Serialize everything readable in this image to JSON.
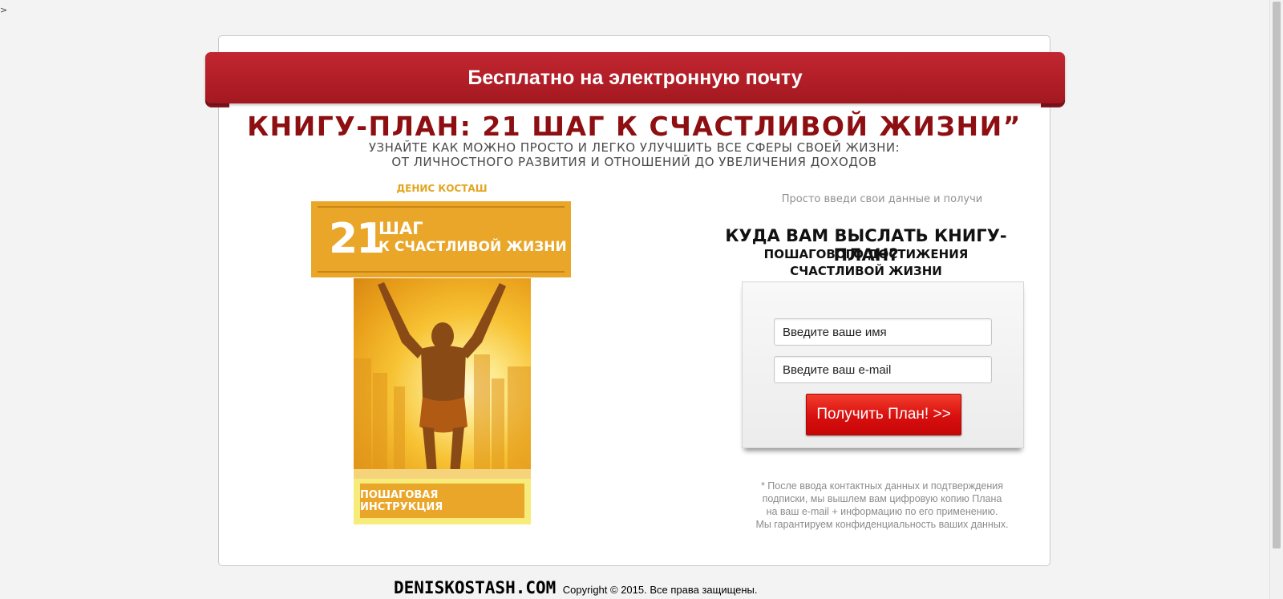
{
  "page": {
    "stray_mark": ">"
  },
  "banner": {
    "title": "Бесплатно на электронную почту"
  },
  "headline": {
    "title": "КНИГУ-ПЛАН: 21 ШАГ К СЧАСТЛИВОЙ ЖИЗНИ”",
    "subtitle_line1": "УЗНАЙТЕ КАК МОЖНО ПРОСТО И ЛЕГКО УЛУЧШИТЬ ВСЕ СФЕРЫ СВОЕЙ ЖИЗНИ:",
    "subtitle_line2": "ОТ ЛИЧНОСТНОГО РАЗВИТИЯ И ОТНОШЕНИЙ  ДО УВЕЛИЧЕНИЯ ДОХОДОВ"
  },
  "book_cover": {
    "author": "ДЕНИС КОСТАШ",
    "number": "21",
    "word": "ШАГ",
    "subtitle": "К СЧАСТЛИВОЙ ЖИЗНИ",
    "bottom_label": "ПОШАГОВАЯ ИНСТРУКЦИЯ",
    "accent_color": "#e9a629"
  },
  "form": {
    "intro": "Просто введи свои данные и получи",
    "heading": "КУДА ВАМ ВЫСЛАТЬ КНИГУ-ПЛАН?",
    "subheading_line1": "ПОШАГОВОГО ДОСТИЖЕНИЯ",
    "subheading_line2": "СЧАСТЛИВОЙ ЖИЗНИ",
    "name_placeholder": "Введите ваше имя",
    "email_placeholder": "Введите ваш e-mail",
    "submit_label": "Получить План! >>",
    "submit_color": "#d80f0f",
    "disclaimer_line1": "* После ввода контактных данных и подтверждения",
    "disclaimer_line2": "подписки, мы вышлем вам цифровую копию Плана",
    "disclaimer_line3": "на ваш e-mail + информацию по его применению.",
    "disclaimer_line4": "Мы гарантируем конфиденциальность ваших данных."
  },
  "footer": {
    "brand": "DENISKOSTASH.COM",
    "copyright": "Copyright © 2015. Все права защищены."
  },
  "colors": {
    "banner": "#b21e27",
    "headline": "#8e0f12",
    "page_background": "#f3f3f3"
  }
}
